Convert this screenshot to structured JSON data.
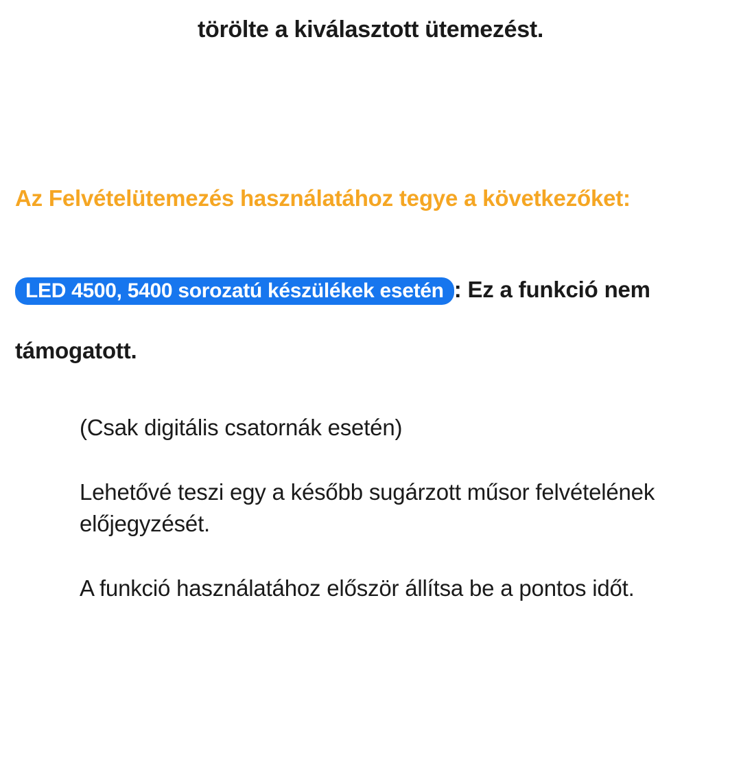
{
  "top_line": "törölte a kiválasztott ütemezést.",
  "section_heading": "Az Felvételütemezés használatához tegye a következőket:",
  "pill_label": "LED 4500, 5400 sorozatú készülékek esetén",
  "main_sentence_after_pill": ": Ez a funkció nem támogatott.",
  "indented": {
    "line1": "(Csak digitális csatornák esetén)",
    "line2": "Lehetővé teszi egy a később sugárzott műsor felvételének előjegyzését.",
    "line3": "A funkció használatához először állítsa be a pontos időt."
  }
}
